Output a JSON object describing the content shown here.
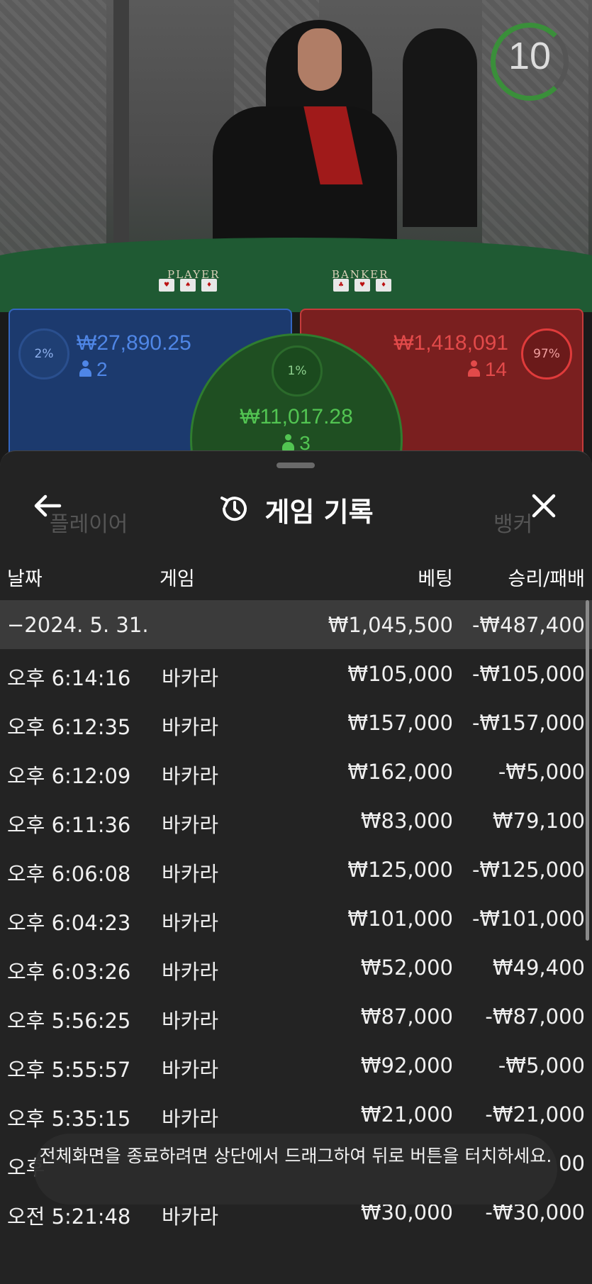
{
  "video": {
    "countdown": "10",
    "table_player_label": "PLAYER",
    "table_banker_label": "BANKER"
  },
  "bets": {
    "player": {
      "percent": "2%",
      "amount": "₩27,890.25",
      "players": "2"
    },
    "tie": {
      "percent": "1%",
      "amount": "₩11,017.28",
      "players": "3"
    },
    "banker": {
      "percent": "97%",
      "amount": "₩1,418,091",
      "players": "14"
    }
  },
  "background_hints": {
    "player": "플레이어",
    "banker": "뱅커"
  },
  "history": {
    "title": "게임 기록",
    "columns": {
      "date": "날짜",
      "game": "게임",
      "bet": "베팅",
      "win_loss": "승리/패배"
    },
    "date_group": {
      "date": "−2024. 5. 31.",
      "bet": "₩1,045,500",
      "win_loss": "-₩487,400"
    },
    "rows": [
      {
        "time": "오후 6:14:16",
        "game": "바카라",
        "bet": "₩105,000",
        "win_loss": "-₩105,000"
      },
      {
        "time": "오후 6:12:35",
        "game": "바카라",
        "bet": "₩157,000",
        "win_loss": "-₩157,000"
      },
      {
        "time": "오후 6:12:09",
        "game": "바카라",
        "bet": "₩162,000",
        "win_loss": "-₩5,000"
      },
      {
        "time": "오후 6:11:36",
        "game": "바카라",
        "bet": "₩83,000",
        "win_loss": "₩79,100"
      },
      {
        "time": "오후 6:06:08",
        "game": "바카라",
        "bet": "₩125,000",
        "win_loss": "-₩125,000"
      },
      {
        "time": "오후 6:04:23",
        "game": "바카라",
        "bet": "₩101,000",
        "win_loss": "-₩101,000"
      },
      {
        "time": "오후 6:03:26",
        "game": "바카라",
        "bet": "₩52,000",
        "win_loss": "₩49,400"
      },
      {
        "time": "오후 5:56:25",
        "game": "바카라",
        "bet": "₩87,000",
        "win_loss": "-₩87,000"
      },
      {
        "time": "오후 5:55:57",
        "game": "바카라",
        "bet": "₩92,000",
        "win_loss": "-₩5,000"
      },
      {
        "time": "오후 5:35:15",
        "game": "바카라",
        "bet": "₩21,000",
        "win_loss": "-₩21,000"
      },
      {
        "time": "오후",
        "game": "",
        "bet": "",
        "win_loss": "00"
      },
      {
        "time": "오전 5:21:48",
        "game": "바카라",
        "bet": "₩30,000",
        "win_loss": "-₩30,000"
      }
    ]
  },
  "toast": {
    "message": "전체화면을 종료하려면 상단에서 드래그하여 뒤로 버튼을 터치하세요."
  }
}
